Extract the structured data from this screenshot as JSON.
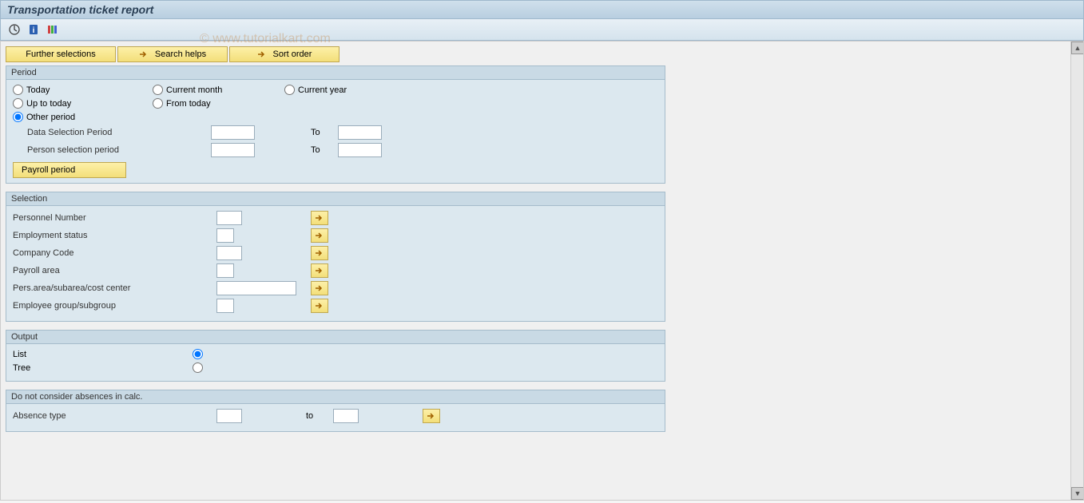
{
  "title": "Transportation ticket report",
  "watermark": "© www.tutorialkart.com",
  "buttons": {
    "further_selections": "Further selections",
    "search_helps": "Search helps",
    "sort_order": "Sort order",
    "payroll_period": "Payroll period"
  },
  "period": {
    "title": "Period",
    "today": "Today",
    "current_month": "Current month",
    "current_year": "Current year",
    "up_to_today": "Up to today",
    "from_today": "From today",
    "other_period": "Other period",
    "data_selection_period": "Data Selection Period",
    "person_selection_period": "Person selection period",
    "to": "To"
  },
  "selection": {
    "title": "Selection",
    "personnel_number": "Personnel Number",
    "employment_status": "Employment status",
    "company_code": "Company Code",
    "payroll_area": "Payroll area",
    "pers_area": "Pers.area/subarea/cost center",
    "employee_group": "Employee group/subgroup"
  },
  "output": {
    "title": "Output",
    "list": "List",
    "tree": "Tree"
  },
  "absences": {
    "title": "Do not consider absences in calc.",
    "absence_type": "Absence type",
    "to": "to"
  }
}
